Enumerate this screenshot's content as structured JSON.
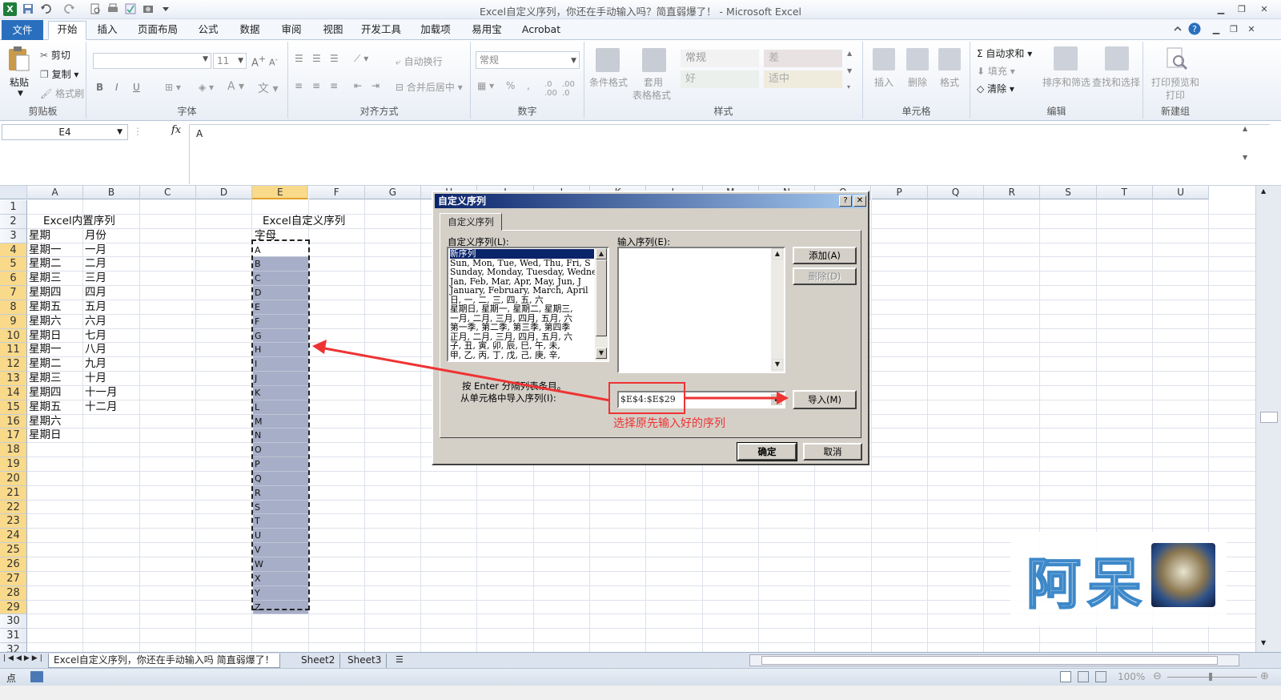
{
  "window": {
    "title": "Excel自定义序列，你还在手动输入吗？简直弱爆了！ - Microsoft Excel",
    "controls": [
      "▁",
      "❐",
      "✕"
    ]
  },
  "tabs": [
    {
      "label": "文件",
      "x": 0
    },
    {
      "label": "开始",
      "x": 0
    },
    {
      "label": "插入",
      "x": 0
    },
    {
      "label": "页面布局",
      "x": 0
    },
    {
      "label": "公式",
      "x": 0
    },
    {
      "label": "数据",
      "x": 0
    },
    {
      "label": "审阅",
      "x": 0
    },
    {
      "label": "视图",
      "x": 0
    },
    {
      "label": "开发工具",
      "x": 0
    },
    {
      "label": "加载项",
      "x": 0
    },
    {
      "label": "易用宝",
      "x": 0
    },
    {
      "label": "Acrobat",
      "x": 0
    }
  ],
  "ribbon": {
    "clipboard": {
      "name": "剪贴板",
      "paste": "粘贴",
      "cut": "剪切",
      "copy": "复制",
      "format_painter": "格式刷"
    },
    "font": {
      "name": "字体",
      "size": "11",
      "bold": "B",
      "italic": "I",
      "underline": "U"
    },
    "alignment": {
      "name": "对齐方式",
      "wrap": "自动换行",
      "merge": "合并后居中"
    },
    "number": {
      "name": "数字",
      "format": "常规",
      "percent": "%",
      "comma": ","
    },
    "styles": {
      "name": "样式",
      "conditional": "条件格式",
      "table_format_1": "套用",
      "table_format_2": "表格格式",
      "cell_normal": "常规",
      "cell_bad": "差",
      "cell_good": "好",
      "cell_neutral": "适中"
    },
    "cells": {
      "name": "单元格",
      "insert": "插入",
      "delete": "删除",
      "format": "格式"
    },
    "editing": {
      "name": "编辑",
      "autosum": "自动求和",
      "fill": "填充",
      "clear": "清除",
      "sort": "排序和筛选",
      "find": "查找和选择"
    },
    "newgroup": {
      "name": "新建组",
      "print1": "打印预览和",
      "print2": "打印"
    }
  },
  "formula_bar": {
    "name_box": "E4",
    "fx": "fx",
    "content": "A"
  },
  "grid": {
    "columns": [
      "A",
      "B",
      "C",
      "D",
      "E",
      "F",
      "G",
      "H",
      "I",
      "J",
      "K",
      "L",
      "M",
      "N",
      "O",
      "P",
      "Q",
      "R",
      "S",
      "T",
      "U"
    ],
    "rows": [
      "1",
      "2",
      "3",
      "4",
      "5",
      "6",
      "7",
      "8",
      "9",
      "10",
      "11",
      "12",
      "13",
      "14",
      "15",
      "16",
      "17",
      "18",
      "19",
      "20",
      "21",
      "22",
      "23",
      "24",
      "25",
      "26",
      "27",
      "28",
      "29",
      "30",
      "31",
      "32"
    ],
    "a2": "Excel内置序列",
    "a3": "星期",
    "b3": "月份",
    "e2": "Excel自定义序列",
    "e3": "字母",
    "col_a": [
      "星期一",
      "星期二",
      "星期三",
      "星期四",
      "星期五",
      "星期六",
      "星期日",
      "星期一",
      "星期二",
      "星期三",
      "星期四",
      "星期五",
      "星期六",
      "星期日"
    ],
    "col_b": [
      "一月",
      "二月",
      "三月",
      "四月",
      "五月",
      "六月",
      "七月",
      "八月",
      "九月",
      "十月",
      "十一月",
      "十二月"
    ],
    "col_e": [
      "A",
      "B",
      "C",
      "D",
      "E",
      "F",
      "G",
      "H",
      "I",
      "J",
      "K",
      "L",
      "M",
      "N",
      "O",
      "P",
      "Q",
      "R",
      "S",
      "T",
      "U",
      "V",
      "W",
      "X",
      "Y",
      "Z"
    ]
  },
  "dialog": {
    "title": "自定义序列",
    "help": "?",
    "close": "✕",
    "tab": "自定义序列",
    "list_label": "自定义序列(L):",
    "input_label": "输入序列(E):",
    "list_items": [
      "新序列",
      "Sun, Mon, Tue, Wed, Thu, Fri, S",
      "Sunday, Monday, Tuesday, Wednes",
      "Jan, Feb, Mar, Apr, May, Jun, J",
      "January, February, March, April",
      "日, 一, 二, 三, 四, 五, 六",
      "星期日, 星期一, 星期二, 星期三,",
      "一月, 二月, 三月, 四月, 五月, 六",
      "第一季, 第二季, 第三季, 第四季",
      "正月, 二月, 三月, 四月, 五月, 六",
      "子, 丑, 寅, 卯, 辰, 巳, 午, 未,",
      "甲, 乙, 丙, 丁, 戊, 己, 庚, 辛,"
    ],
    "add_button": "添加(A)",
    "delete_button": "删除(D)",
    "hint": "按 Enter 分隔列表条目。",
    "import_label": "从单元格中导入序列(I):",
    "import_range": "$E$4:$E$29",
    "import_button": "导入(M)",
    "ok_button": "确定",
    "cancel_button": "取消"
  },
  "annotation": {
    "text": "选择原先输入好的序列",
    "color": "#ee3333"
  },
  "watermark": {
    "text": "阿呆"
  },
  "sheet_tabs": [
    "Excel自定义序列，你还在手动输入吗 简直弱爆了！",
    "Sheet2",
    "Sheet3"
  ],
  "status": {
    "mode": "点",
    "zoom": "100%"
  }
}
